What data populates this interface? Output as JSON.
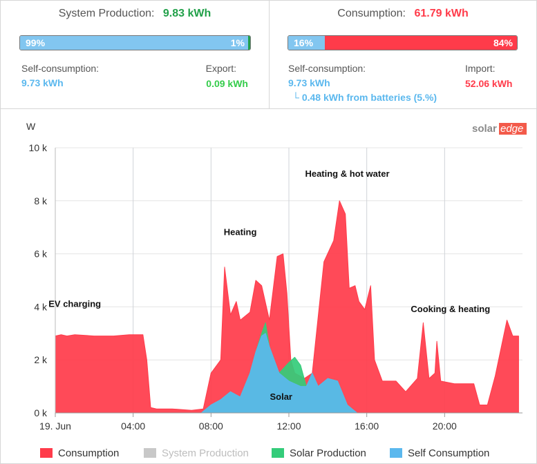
{
  "production": {
    "title": "System Production:",
    "value": "9.83 kWh",
    "self_pct_label": "99%",
    "export_pct_label": "1%",
    "self_fraction": 0.99,
    "self_label": "Self-consumption:",
    "self_value": "9.73 kWh",
    "export_label": "Export:",
    "export_value": "0.09 kWh"
  },
  "consumption": {
    "title": "Consumption:",
    "value": "61.79 kWh",
    "self_pct_label": "16%",
    "import_pct_label": "84%",
    "self_fraction": 0.16,
    "self_label": "Self-consumption:",
    "self_value": "9.73 kWh",
    "battery_note": "0.48 kWh from batteries (5.%)",
    "import_label": "Import:",
    "import_value": "52.06 kWh"
  },
  "brand": {
    "part1": "solar",
    "part2": "edge"
  },
  "colors": {
    "consumption": "#ff3b4a",
    "self": "#5bb8ee",
    "solar": "#34cc7a",
    "export_green": "#21a049",
    "system_grey": "#c8c8c8"
  },
  "chart_data": {
    "type": "area",
    "ylabel": "W",
    "ylim": [
      0,
      10000
    ],
    "xlim": [
      0,
      24
    ],
    "y_ticks": [
      0,
      2000,
      4000,
      6000,
      8000,
      10000
    ],
    "y_tick_labels": [
      "0 k",
      "2 k",
      "4 k",
      "6 k",
      "8 k",
      "10 k"
    ],
    "x_ticks": [
      0,
      4,
      8,
      12,
      16,
      20
    ],
    "x_tick_labels": [
      "19. Jun",
      "04:00",
      "08:00",
      "12:00",
      "16:00",
      "20:00"
    ],
    "grid": true,
    "legend": "bottom",
    "series": [
      {
        "name": "Consumption",
        "color": "#ff3b4a",
        "points": [
          [
            0,
            2900
          ],
          [
            0.3,
            2950
          ],
          [
            0.6,
            2900
          ],
          [
            1,
            2950
          ],
          [
            2,
            2900
          ],
          [
            3,
            2900
          ],
          [
            3.8,
            2950
          ],
          [
            4.5,
            2950
          ],
          [
            4.7,
            2000
          ],
          [
            4.9,
            200
          ],
          [
            5.2,
            150
          ],
          [
            6,
            150
          ],
          [
            7,
            100
          ],
          [
            7.6,
            150
          ],
          [
            8,
            1500
          ],
          [
            8.5,
            2000
          ],
          [
            8.7,
            5500
          ],
          [
            9,
            3700
          ],
          [
            9.3,
            4200
          ],
          [
            9.5,
            3500
          ],
          [
            10,
            3800
          ],
          [
            10.3,
            5000
          ],
          [
            10.6,
            4800
          ],
          [
            11,
            3500
          ],
          [
            11.4,
            5900
          ],
          [
            11.7,
            6000
          ],
          [
            11.9,
            4500
          ],
          [
            12.1,
            2000
          ],
          [
            12.3,
            1500
          ],
          [
            12.8,
            1300
          ],
          [
            13.2,
            1500
          ],
          [
            13.8,
            5700
          ],
          [
            14.3,
            6500
          ],
          [
            14.6,
            8000
          ],
          [
            14.9,
            7500
          ],
          [
            15.1,
            4700
          ],
          [
            15.4,
            4800
          ],
          [
            15.6,
            4200
          ],
          [
            15.9,
            3900
          ],
          [
            16.2,
            4800
          ],
          [
            16.4,
            2000
          ],
          [
            16.8,
            1200
          ],
          [
            17.5,
            1200
          ],
          [
            18,
            800
          ],
          [
            18.6,
            1300
          ],
          [
            18.9,
            3400
          ],
          [
            19.2,
            1300
          ],
          [
            19.5,
            1500
          ],
          [
            19.6,
            2700
          ],
          [
            19.8,
            1200
          ],
          [
            20.5,
            1100
          ],
          [
            21.5,
            1100
          ],
          [
            21.8,
            300
          ],
          [
            22.2,
            300
          ],
          [
            22.6,
            1400
          ],
          [
            23.2,
            3500
          ],
          [
            23.5,
            2900
          ],
          [
            23.8,
            2900
          ]
        ]
      },
      {
        "name": "System Production",
        "color": "#c8c8c8",
        "points": []
      },
      {
        "name": "Solar Production",
        "color": "#34cc7a",
        "points": [
          [
            7.5,
            0
          ],
          [
            8,
            300
          ],
          [
            8.5,
            500
          ],
          [
            9,
            800
          ],
          [
            9.5,
            600
          ],
          [
            10,
            1500
          ],
          [
            10.3,
            2300
          ],
          [
            10.6,
            3000
          ],
          [
            10.8,
            3400
          ],
          [
            11,
            2500
          ],
          [
            11.5,
            1500
          ],
          [
            12,
            1900
          ],
          [
            12.3,
            2100
          ],
          [
            12.6,
            1800
          ],
          [
            12.9,
            1000
          ],
          [
            13.2,
            1500
          ],
          [
            13.5,
            1000
          ],
          [
            14,
            1300
          ],
          [
            14.5,
            1200
          ],
          [
            15,
            300
          ],
          [
            15.5,
            0
          ]
        ]
      },
      {
        "name": "Self Consumption",
        "color": "#5bb8ee",
        "points": [
          [
            7.5,
            0
          ],
          [
            8,
            300
          ],
          [
            8.5,
            500
          ],
          [
            9,
            800
          ],
          [
            9.5,
            600
          ],
          [
            10,
            1500
          ],
          [
            10.3,
            2300
          ],
          [
            10.6,
            2900
          ],
          [
            10.8,
            3000
          ],
          [
            11,
            2500
          ],
          [
            11.5,
            1500
          ],
          [
            12,
            1200
          ],
          [
            12.3,
            1100
          ],
          [
            12.6,
            1000
          ],
          [
            12.9,
            1000
          ],
          [
            13.2,
            1500
          ],
          [
            13.5,
            1000
          ],
          [
            14,
            1300
          ],
          [
            14.5,
            1200
          ],
          [
            15,
            300
          ],
          [
            15.5,
            0
          ]
        ]
      }
    ],
    "annotations": [
      {
        "text": "EV charging",
        "x": 1.0,
        "y": 4000
      },
      {
        "text": "Heating",
        "x": 9.5,
        "y": 6700
      },
      {
        "text": "Heating & hot water",
        "x": 15.0,
        "y": 8900
      },
      {
        "text": "Solar",
        "x": 11.6,
        "y": 500
      },
      {
        "text": "Cooking & heating",
        "x": 20.3,
        "y": 3800
      }
    ]
  },
  "legend_items": [
    {
      "label": "Consumption",
      "color": "#ff3b4a",
      "muted": false
    },
    {
      "label": "System Production",
      "color": "#c8c8c8",
      "muted": true
    },
    {
      "label": "Solar Production",
      "color": "#34cc7a",
      "muted": false
    },
    {
      "label": "Self Consumption",
      "color": "#5bb8ee",
      "muted": false
    }
  ]
}
